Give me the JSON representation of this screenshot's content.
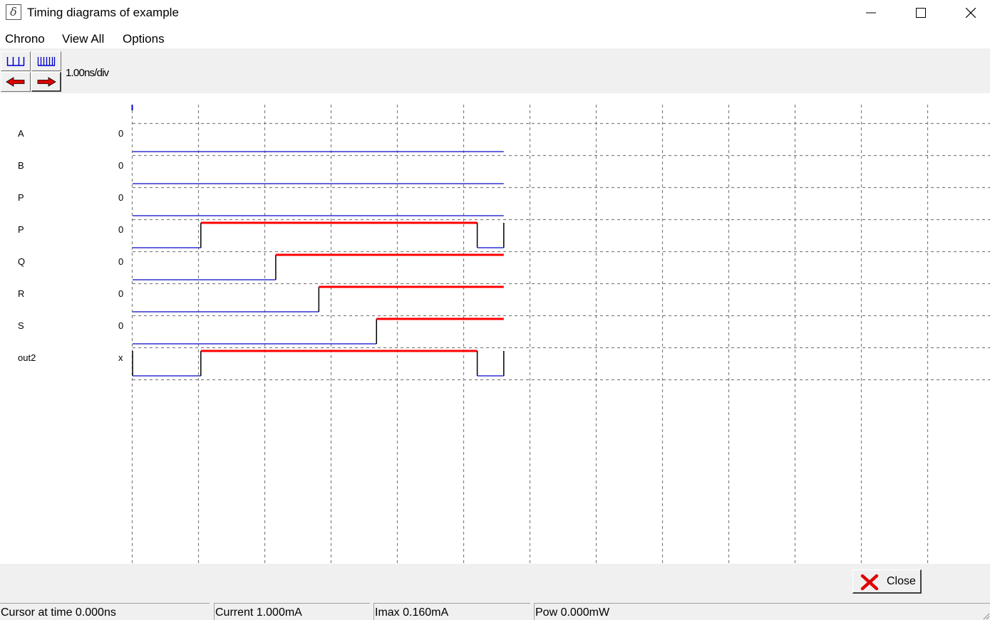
{
  "window": {
    "title": "Timing diagrams of example",
    "icon": "delta-icon"
  },
  "menu": {
    "items": [
      "Chrono",
      "View All",
      "Options"
    ]
  },
  "toolbar": {
    "zoom_in_icon": "wide-grid-icon",
    "zoom_out_icon": "dense-grid-icon",
    "scroll_left_icon": "red-left-arrow-icon",
    "scroll_right_icon": "red-right-arrow-icon",
    "scale": "1.00ns/div"
  },
  "diagram": {
    "colors": {
      "low": "#3030d0",
      "high": "#ff0000",
      "edge": "#000000",
      "grid": "#808080"
    },
    "end_time_ns": 5.6,
    "signals": [
      {
        "name": "A",
        "initial": "0",
        "transitions": []
      },
      {
        "name": "B",
        "initial": "0",
        "transitions": []
      },
      {
        "name": "P",
        "initial": "0",
        "transitions": []
      },
      {
        "name": "P",
        "initial": "0",
        "transitions": [
          [
            1.03,
            1
          ],
          [
            5.2,
            0
          ],
          [
            5.6,
            1
          ]
        ]
      },
      {
        "name": "Q",
        "initial": "0",
        "transitions": [
          [
            2.16,
            1
          ]
        ]
      },
      {
        "name": "R",
        "initial": "0",
        "transitions": [
          [
            2.81,
            1
          ]
        ]
      },
      {
        "name": "S",
        "initial": "0",
        "transitions": [
          [
            3.68,
            1
          ]
        ]
      },
      {
        "name": "out2",
        "initial": "x",
        "transitions": [
          [
            1.03,
            1
          ],
          [
            5.2,
            0
          ],
          [
            5.6,
            1
          ]
        ]
      }
    ]
  },
  "buttons": {
    "close_label": "Close",
    "close_icon": "red-x-icon"
  },
  "status": {
    "cursor": "Cursor at time 0.000ns",
    "current": "Current 1.000mA",
    "imax": "Imax 0.160mA",
    "power": "Pow 0.000mW"
  }
}
